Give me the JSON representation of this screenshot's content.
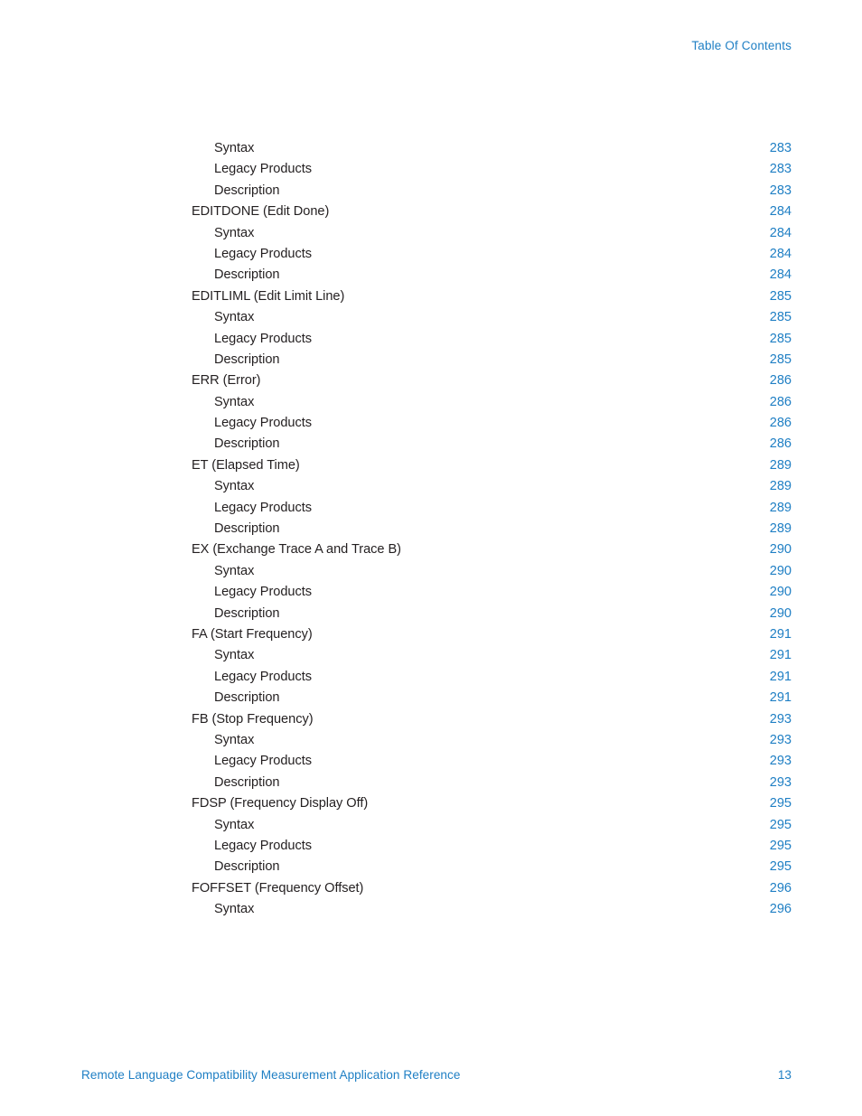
{
  "header": {
    "title": "Table Of Contents"
  },
  "colors": {
    "accent_blue": "#1f7fc4",
    "body_text": "#231f20",
    "page_background": "#ffffff"
  },
  "toc": {
    "entries": [
      {
        "label": "Syntax",
        "page": "283",
        "level": 2
      },
      {
        "label": "Legacy Products",
        "page": "283",
        "level": 2
      },
      {
        "label": "Description",
        "page": "283",
        "level": 2
      },
      {
        "label": "EDITDONE (Edit Done)",
        "page": "284",
        "level": 1
      },
      {
        "label": "Syntax",
        "page": "284",
        "level": 2
      },
      {
        "label": "Legacy Products",
        "page": "284",
        "level": 2
      },
      {
        "label": "Description",
        "page": "284",
        "level": 2
      },
      {
        "label": "EDITLIML (Edit Limit Line)",
        "page": "285",
        "level": 1
      },
      {
        "label": "Syntax",
        "page": "285",
        "level": 2
      },
      {
        "label": "Legacy Products",
        "page": "285",
        "level": 2
      },
      {
        "label": "Description",
        "page": "285",
        "level": 2
      },
      {
        "label": "ERR (Error)",
        "page": "286",
        "level": 1
      },
      {
        "label": "Syntax",
        "page": "286",
        "level": 2
      },
      {
        "label": "Legacy Products",
        "page": "286",
        "level": 2
      },
      {
        "label": "Description",
        "page": "286",
        "level": 2
      },
      {
        "label": "ET (Elapsed Time)",
        "page": "289",
        "level": 1
      },
      {
        "label": "Syntax",
        "page": "289",
        "level": 2
      },
      {
        "label": "Legacy Products",
        "page": "289",
        "level": 2
      },
      {
        "label": "Description",
        "page": "289",
        "level": 2
      },
      {
        "label": "EX (Exchange Trace A and Trace B)",
        "page": "290",
        "level": 1
      },
      {
        "label": "Syntax",
        "page": "290",
        "level": 2
      },
      {
        "label": "Legacy Products",
        "page": "290",
        "level": 2
      },
      {
        "label": "Description",
        "page": "290",
        "level": 2
      },
      {
        "label": "FA (Start Frequency)",
        "page": "291",
        "level": 1
      },
      {
        "label": "Syntax",
        "page": "291",
        "level": 2
      },
      {
        "label": "Legacy Products",
        "page": "291",
        "level": 2
      },
      {
        "label": "Description",
        "page": "291",
        "level": 2
      },
      {
        "label": "FB (Stop Frequency)",
        "page": "293",
        "level": 1
      },
      {
        "label": "Syntax",
        "page": "293",
        "level": 2
      },
      {
        "label": "Legacy Products",
        "page": "293",
        "level": 2
      },
      {
        "label": "Description",
        "page": "293",
        "level": 2
      },
      {
        "label": "FDSP (Frequency Display Off)",
        "page": "295",
        "level": 1
      },
      {
        "label": "Syntax",
        "page": "295",
        "level": 2
      },
      {
        "label": "Legacy Products",
        "page": "295",
        "level": 2
      },
      {
        "label": "Description",
        "page": "295",
        "level": 2
      },
      {
        "label": "FOFFSET (Frequency Offset)",
        "page": "296",
        "level": 1
      },
      {
        "label": "Syntax",
        "page": "296",
        "level": 2
      }
    ]
  },
  "footer": {
    "title": "Remote Language Compatibility Measurement Application Reference",
    "page_number": "13"
  }
}
